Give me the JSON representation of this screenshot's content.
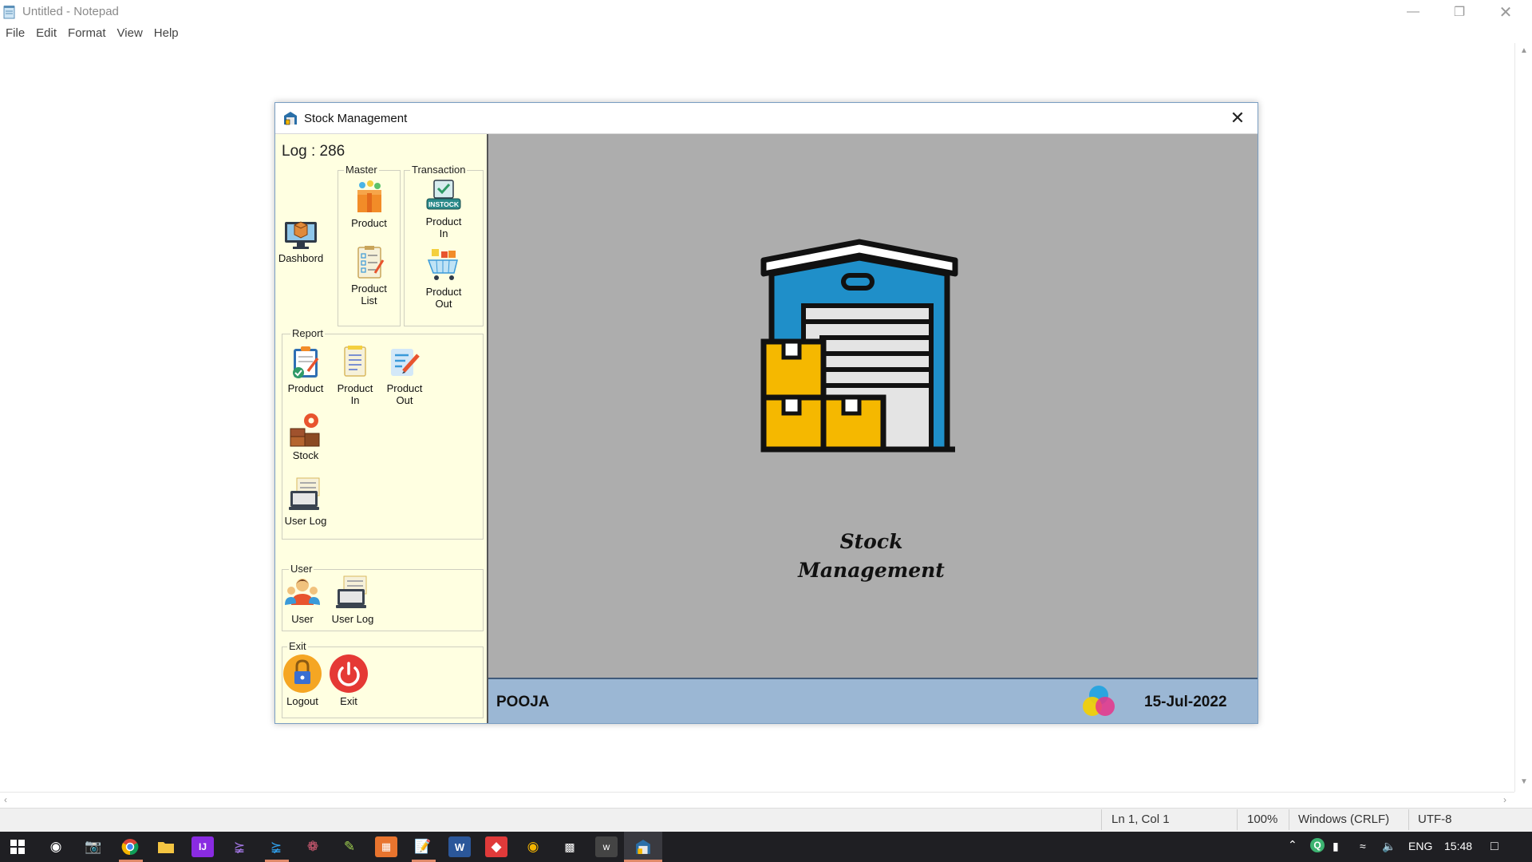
{
  "notepad": {
    "title": "Untitled - Notepad",
    "menu": [
      "File",
      "Edit",
      "Format",
      "View",
      "Help"
    ],
    "status": {
      "position": "Ln 1, Col 1",
      "zoom": "100%",
      "line_ending": "Windows (CRLF)",
      "encoding": "UTF-8"
    }
  },
  "app": {
    "title": "Stock Management",
    "log_label": "Log : 286",
    "dashboard_label": "Dashbord",
    "groups": {
      "master": {
        "title": "Master",
        "items": [
          "Product",
          "Product List"
        ]
      },
      "transaction": {
        "title": "Transaction",
        "items": [
          "Product In",
          "Product Out"
        ],
        "instock_badge": "INSTOCK"
      },
      "report": {
        "title": "Report",
        "items": [
          "Product",
          "Product In",
          "Product Out",
          "Stock",
          "User Log"
        ]
      },
      "user": {
        "title": "User",
        "items": [
          "User",
          "User Log"
        ]
      },
      "exit": {
        "title": "Exit",
        "items": [
          "Logout",
          "Exit"
        ]
      }
    },
    "logo_text_line1": "Stock",
    "logo_text_line2": "Management",
    "footer": {
      "user": "POOJA",
      "date": "15-Jul-2022"
    }
  },
  "taskbar": {
    "language": "ENG",
    "time": "15:48"
  },
  "colors": {
    "sidebar_bg": "#ffffe1",
    "main_bg": "#adadad",
    "footer_bg": "#9bb7d4",
    "warehouse_blue": "#1f8fc9",
    "box_yellow": "#f5b800"
  }
}
